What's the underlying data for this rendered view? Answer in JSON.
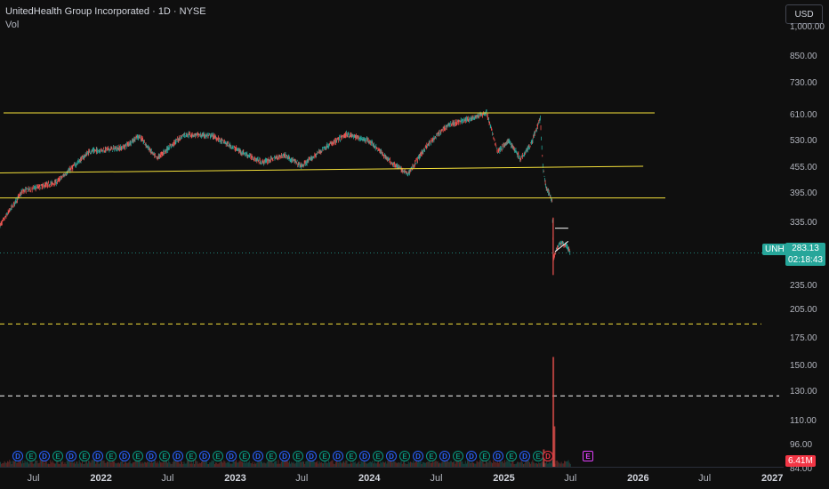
{
  "header": {
    "title": "UnitedHealth Group Incorporated · 1D · NYSE",
    "vol_label": "Vol"
  },
  "currency_button": "USD",
  "price_badge": {
    "symbol": "UNH",
    "price": "283.13",
    "countdown": "02:18:43",
    "color": "#26a69a"
  },
  "volume_badge": {
    "value": "6.41M",
    "color": "#f23645"
  },
  "y_axis_ticks": [
    "1,000.00",
    "850.00",
    "730.00",
    "610.00",
    "530.00",
    "455.00",
    "395.00",
    "335.00",
    "235.00",
    "205.00",
    "175.00",
    "150.00",
    "130.00",
    "110.00",
    "96.00",
    "84.00"
  ],
  "x_axis_ticks": [
    {
      "label": "Jul",
      "year": false
    },
    {
      "label": "2022",
      "year": true
    },
    {
      "label": "Jul",
      "year": false
    },
    {
      "label": "2023",
      "year": true
    },
    {
      "label": "Jul",
      "year": false
    },
    {
      "label": "2024",
      "year": true
    },
    {
      "label": "Jul",
      "year": false
    },
    {
      "label": "2025",
      "year": true
    },
    {
      "label": "Jul",
      "year": false
    },
    {
      "label": "2026",
      "year": true
    },
    {
      "label": "Jul",
      "year": false
    },
    {
      "label": "2027",
      "year": true
    }
  ],
  "events": [
    "D",
    "E",
    "D",
    "E",
    "D",
    "E",
    "D",
    "E",
    "D",
    "E",
    "D",
    "E",
    "D",
    "E",
    "D",
    "E",
    "D",
    "E",
    "D",
    "E",
    "D",
    "E",
    "D",
    "E",
    "D",
    "E",
    "D",
    "E",
    "D",
    "E",
    "D",
    "E",
    "D",
    "E",
    "D",
    "E",
    "D",
    "E",
    "D",
    "E",
    "D",
    "E"
  ],
  "colors": {
    "up": "#26a69a",
    "down": "#ef5350",
    "support": "#f5e13a",
    "background": "#0f0f0f"
  },
  "chart_data": {
    "type": "candlestick",
    "symbol": "UNH",
    "interval": "1D",
    "exchange": "NYSE",
    "scale": "log",
    "ylim": [
      80,
      1100
    ],
    "x_range": [
      "2021-04-01",
      "2027-02-01"
    ],
    "last_price": 283.13,
    "last_volume": "6.41M",
    "price_path": [
      {
        "date": "2021-04-01",
        "close": 330
      },
      {
        "date": "2021-06-01",
        "close": 400
      },
      {
        "date": "2021-09-01",
        "close": 420
      },
      {
        "date": "2021-12-01",
        "close": 500
      },
      {
        "date": "2022-03-01",
        "close": 510
      },
      {
        "date": "2022-04-15",
        "close": 545
      },
      {
        "date": "2022-06-01",
        "close": 480
      },
      {
        "date": "2022-08-15",
        "close": 550
      },
      {
        "date": "2022-11-01",
        "close": 545
      },
      {
        "date": "2023-01-15",
        "close": 500
      },
      {
        "date": "2023-03-15",
        "close": 470
      },
      {
        "date": "2023-05-15",
        "close": 490
      },
      {
        "date": "2023-07-01",
        "close": 460
      },
      {
        "date": "2023-09-01",
        "close": 510
      },
      {
        "date": "2023-11-01",
        "close": 550
      },
      {
        "date": "2024-01-01",
        "close": 530
      },
      {
        "date": "2024-03-01",
        "close": 470
      },
      {
        "date": "2024-04-15",
        "close": 440
      },
      {
        "date": "2024-06-01",
        "close": 510
      },
      {
        "date": "2024-08-01",
        "close": 580
      },
      {
        "date": "2024-10-01",
        "close": 600
      },
      {
        "date": "2024-11-15",
        "close": 620
      },
      {
        "date": "2024-12-15",
        "close": 500
      },
      {
        "date": "2025-01-15",
        "close": 530
      },
      {
        "date": "2025-02-15",
        "close": 480
      },
      {
        "date": "2025-03-15",
        "close": 520
      },
      {
        "date": "2025-04-10",
        "close": 600
      },
      {
        "date": "2025-04-17",
        "close": 460
      },
      {
        "date": "2025-04-25",
        "close": 410
      },
      {
        "date": "2025-05-12",
        "close": 380
      },
      {
        "date": "2025-05-16",
        "close": 275
      },
      {
        "date": "2025-06-01",
        "close": 300
      },
      {
        "date": "2025-06-20",
        "close": 295
      },
      {
        "date": "2025-07-01",
        "close": 283
      }
    ],
    "horizontal_levels": [
      {
        "price": 620,
        "style": "solid",
        "color": "#f5e13a"
      },
      {
        "price": 385,
        "style": "solid",
        "color": "#f5e13a"
      },
      {
        "price": 190,
        "style": "dashed",
        "color": "#f5e13a"
      },
      {
        "price": 127,
        "style": "dashed",
        "color": "#ffffff"
      }
    ],
    "trend_lines": [
      {
        "from": {
          "date": "2021-04-01",
          "price": 443
        },
        "to": {
          "date": "2026-01-15",
          "price": 460
        },
        "color": "#f5e13a"
      }
    ],
    "annotations": [
      {
        "type": "white-line",
        "from": {
          "date": "2025-05-20",
          "price": 325
        },
        "to": {
          "date": "2025-06-25",
          "price": 325
        }
      },
      {
        "type": "white-line",
        "from": {
          "date": "2025-05-20",
          "price": 285
        },
        "to": {
          "date": "2025-06-25",
          "price": 302
        }
      }
    ],
    "volume_spikes": [
      {
        "date": "2025-05-13",
        "volume_level": 0.95
      },
      {
        "date": "2025-05-16",
        "volume_level": 0.35
      },
      {
        "date": "2025-04-17",
        "volume_level": 0.15
      }
    ]
  }
}
